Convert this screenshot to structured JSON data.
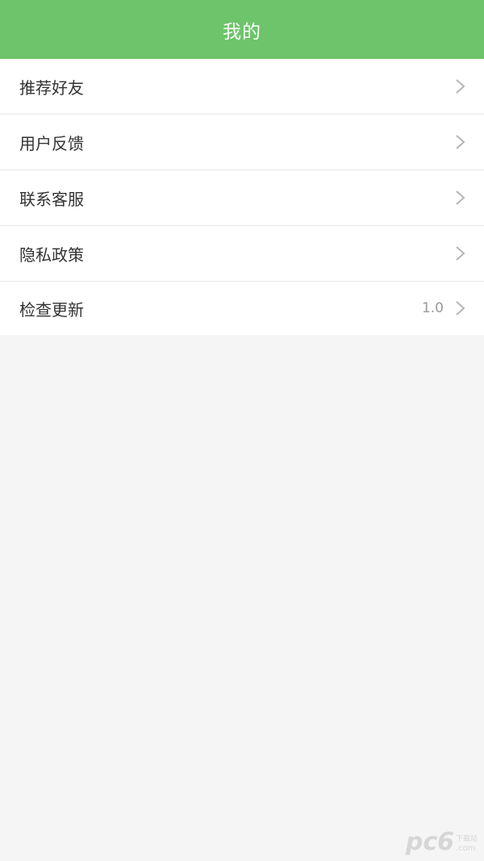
{
  "header": {
    "title": "我的"
  },
  "menu": {
    "items": [
      {
        "label": "推荐好友",
        "value": ""
      },
      {
        "label": "用户反馈",
        "value": ""
      },
      {
        "label": "联系客服",
        "value": ""
      },
      {
        "label": "隐私政策",
        "value": ""
      },
      {
        "label": "检查更新",
        "value": "1.0"
      }
    ]
  },
  "watermark": {
    "logo": "pc6",
    "cn": "下载站",
    "com": ".com"
  },
  "colors": {
    "header_bg": "#6dc46a",
    "page_bg": "#f5f5f5"
  }
}
